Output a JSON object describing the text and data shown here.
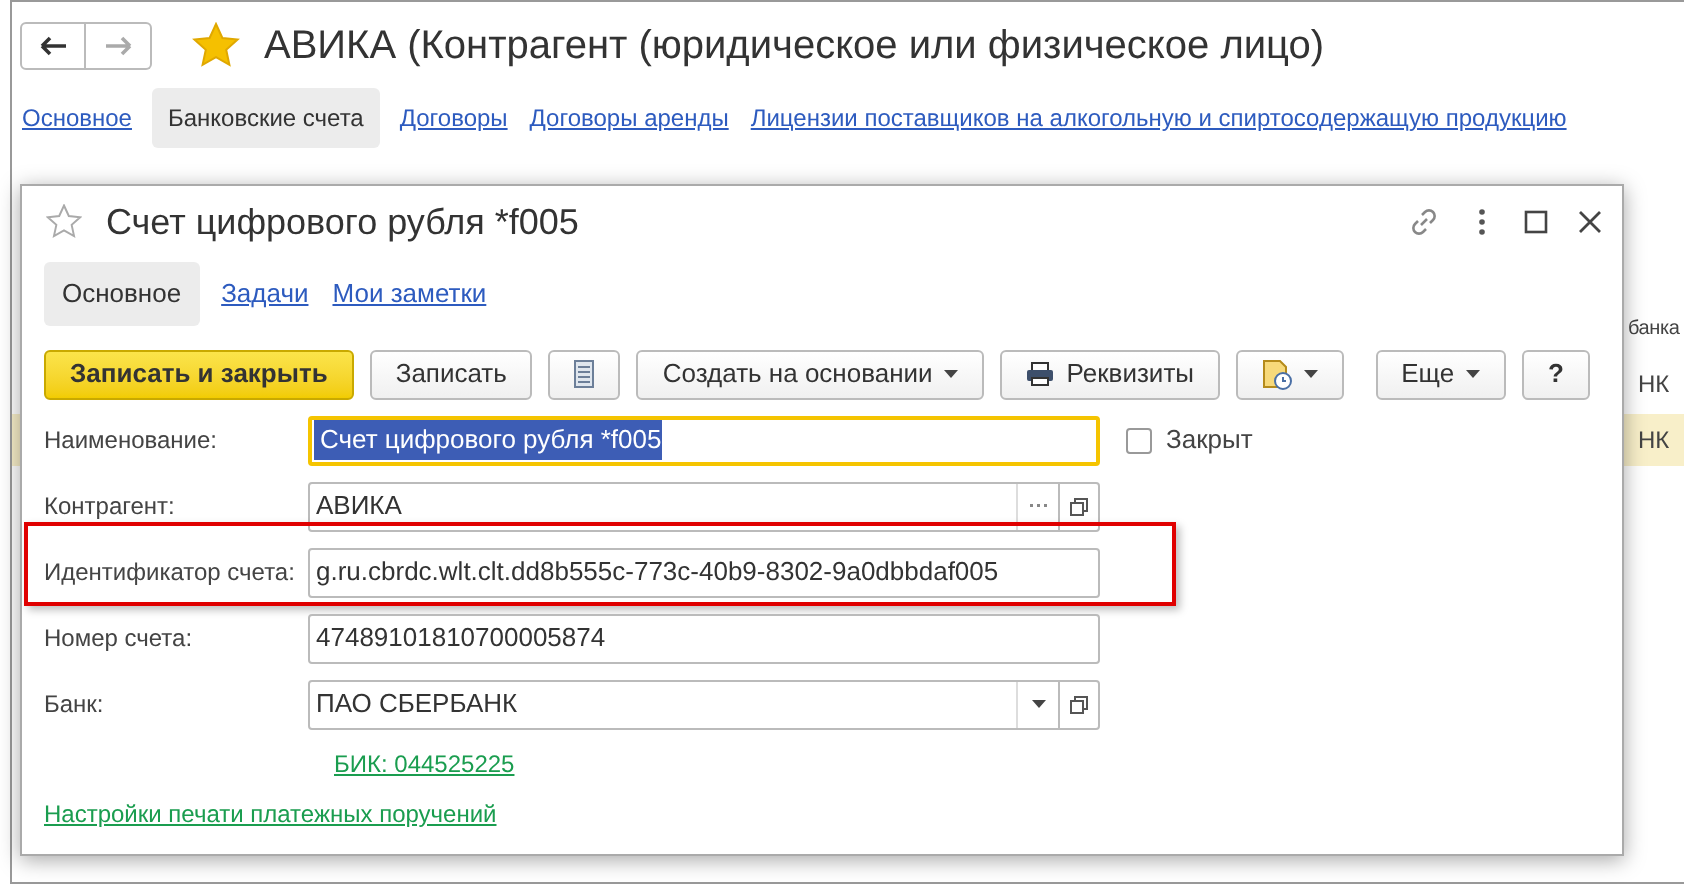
{
  "window": {
    "title": "АВИКА (Контрагент (юридическое или физическое лицо)",
    "favorite": true
  },
  "tabs": [
    {
      "label": "Основное",
      "selected": false
    },
    {
      "label": "Банковские счета",
      "selected": true
    },
    {
      "label": "Договоры",
      "selected": false
    },
    {
      "label": "Договоры аренды",
      "selected": false
    },
    {
      "label": "Лицензии поставщиков на алкогольную и спиртосодержащую продукцию",
      "selected": false
    }
  ],
  "background_table": {
    "column_header": "банка",
    "cells": [
      "НК",
      "НК"
    ]
  },
  "dialog": {
    "title": "Счет цифрового рубля *f005",
    "favorite": false,
    "tabs": [
      {
        "label": "Основное",
        "selected": true
      },
      {
        "label": "Задачи",
        "selected": false
      },
      {
        "label": "Мои заметки",
        "selected": false
      }
    ],
    "toolbar": [
      {
        "kind": "primary",
        "label": "Записать и закрыть"
      },
      {
        "kind": "button",
        "label": "Записать"
      },
      {
        "kind": "list-icon"
      },
      {
        "kind": "dropdown",
        "label": "Создать на основании"
      },
      {
        "kind": "print",
        "label": "Реквизиты"
      },
      {
        "kind": "doc-icon-dropdown"
      },
      {
        "kind": "more",
        "label": "Еще"
      },
      {
        "kind": "help",
        "label": "?"
      }
    ],
    "fields": [
      {
        "kind": "name",
        "label": "Наименование:",
        "value": "Счет цифрового рубля *f005",
        "focused": true,
        "checkbox": {
          "label": "Закрыт",
          "checked": false
        }
      },
      {
        "kind": "choice",
        "label": "Контрагент:",
        "value": "АВИКА",
        "focused": false
      },
      {
        "kind": "text",
        "label": "Идентификатор счета:",
        "value": "g.ru.cbrdc.wlt.clt.dd8b555c-773c-40b9-8302-9a0dbbdaf005",
        "focused": false,
        "highlighted": true
      },
      {
        "kind": "text",
        "label": "Номер счета:",
        "value": "47489101810700005874",
        "focused": false
      },
      {
        "kind": "select",
        "label": "Банк:",
        "value": "ПАО СБЕРБАНК",
        "focused": false
      }
    ],
    "bik_link": "БИК: 044525225",
    "print_settings_link": "Настройки печати платежных поручений"
  }
}
